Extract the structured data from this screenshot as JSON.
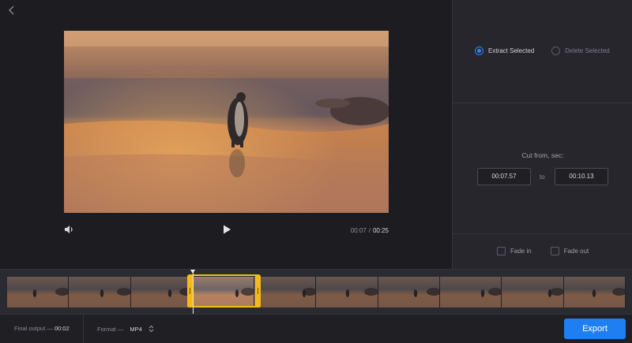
{
  "colors": {
    "accent": "#1f7ef2",
    "selection": "#f3bc14",
    "background": "#1c1c21",
    "panel": "#26262c"
  },
  "nav": {
    "back_icon": "chevron-left-icon"
  },
  "player": {
    "current_time": "00:07",
    "separator": "/",
    "duration": "00:25",
    "volume_icon": "volume-icon",
    "play_icon": "play-icon"
  },
  "mode": {
    "options": [
      {
        "label": "Extract Selected",
        "selected": true
      },
      {
        "label": "Delete Selected",
        "selected": false
      }
    ]
  },
  "cut": {
    "label": "Cut from, sec:",
    "start": "00:07.57",
    "to_label": "to",
    "end": "00:10.13"
  },
  "fades": [
    {
      "label": "Fade in",
      "checked": false
    },
    {
      "label": "Fade out",
      "checked": false
    }
  ],
  "timeline": {
    "frame_count": 10
  },
  "footer": {
    "final_output_label": "Final output —",
    "final_output_value": "00:02",
    "format_label": "Format —",
    "format_value": "MP4",
    "format_icon": "up-down-arrows-icon",
    "export_label": "Export"
  }
}
